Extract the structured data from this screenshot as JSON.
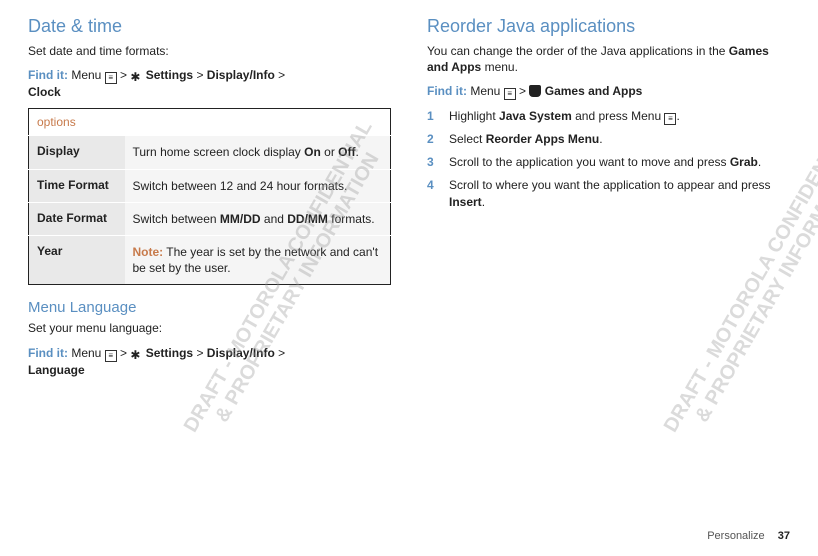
{
  "left": {
    "dateTime": {
      "heading": "Date & time",
      "intro": "Set date and time formats:",
      "findit_label": "Find it:",
      "findit_menu": "Menu",
      "findit_settings": "Settings",
      "findit_path": "Display/Info",
      "findit_end": "Clock",
      "gt": ">",
      "options_header": "options",
      "rows": [
        {
          "name": "Display",
          "desc_pre": "Turn home screen clock display ",
          "b1": "On",
          "mid": " or ",
          "b2": "Off",
          "post": "."
        },
        {
          "name": "Time Format",
          "desc": "Switch between 12 and 24 hour formats."
        },
        {
          "name": "Date Format",
          "desc_pre": "Switch between ",
          "b1": "MM/DD",
          "mid": " and ",
          "b2": "DD/MM",
          "post": " formats."
        },
        {
          "name": "Year",
          "note": "Note:",
          "desc": " The year is set by the network and can't be set by the user."
        }
      ]
    },
    "menuLang": {
      "heading": "Menu Language",
      "intro": "Set your menu language:",
      "findit_label": "Find it:",
      "findit_menu": "Menu",
      "findit_settings": "Settings",
      "findit_path": "Display/Info",
      "findit_end": "Language",
      "gt": ">"
    }
  },
  "right": {
    "reorder": {
      "heading": "Reorder Java applications",
      "intro_pre": "You can change the order of the Java applications in the ",
      "intro_b": "Games and Apps",
      "intro_post": " menu.",
      "findit_label": "Find it:",
      "findit_menu": "Menu",
      "findit_games": "Games and Apps",
      "gt": ">",
      "steps": [
        {
          "n": "1",
          "pre": "Highlight ",
          "b1": "Java System",
          "mid": " and press Menu ",
          "post": ".",
          "has_menu_glyph": true
        },
        {
          "n": "2",
          "pre": "Select ",
          "b1": "Reorder Apps Menu",
          "post": "."
        },
        {
          "n": "3",
          "pre": "Scroll to the application you want to move and press ",
          "b1": "Grab",
          "post": "."
        },
        {
          "n": "4",
          "pre": "Scroll to where you want the application to appear and press ",
          "b1": "Insert",
          "post": "."
        }
      ]
    }
  },
  "footer": {
    "section": "Personalize",
    "page": "37"
  },
  "watermark": "DRAFT - MOTOROLA CONFIDENTIAL\n& PROPRIETARY INFORMATION"
}
